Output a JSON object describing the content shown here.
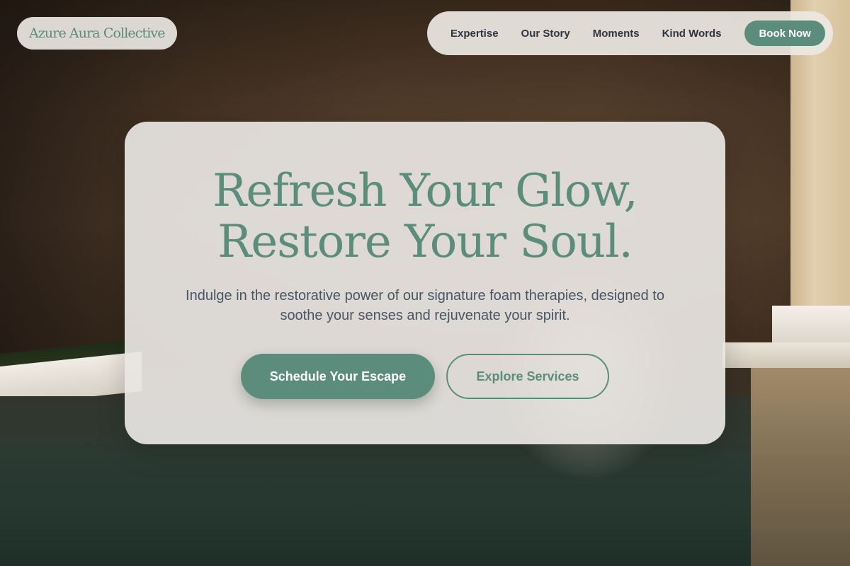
{
  "brand": {
    "name": "Azure Aura Collective"
  },
  "nav": {
    "links": [
      {
        "label": "Expertise"
      },
      {
        "label": "Our Story"
      },
      {
        "label": "Moments"
      },
      {
        "label": "Kind Words"
      }
    ],
    "cta_label": "Book Now"
  },
  "hero": {
    "title_line1": "Refresh Your Glow,",
    "title_line2": "Restore Your Soul.",
    "subtitle": "Indulge in the restorative power of our signature foam therapies, designed to soothe your senses and rejuvenate your spirit.",
    "primary_cta": "Schedule Your Escape",
    "secondary_cta": "Explore Services"
  },
  "colors": {
    "accent": "#5b8c7c",
    "nav_text": "#2e3540",
    "body_text": "#4a5566",
    "panel": "#e8e5e2"
  }
}
